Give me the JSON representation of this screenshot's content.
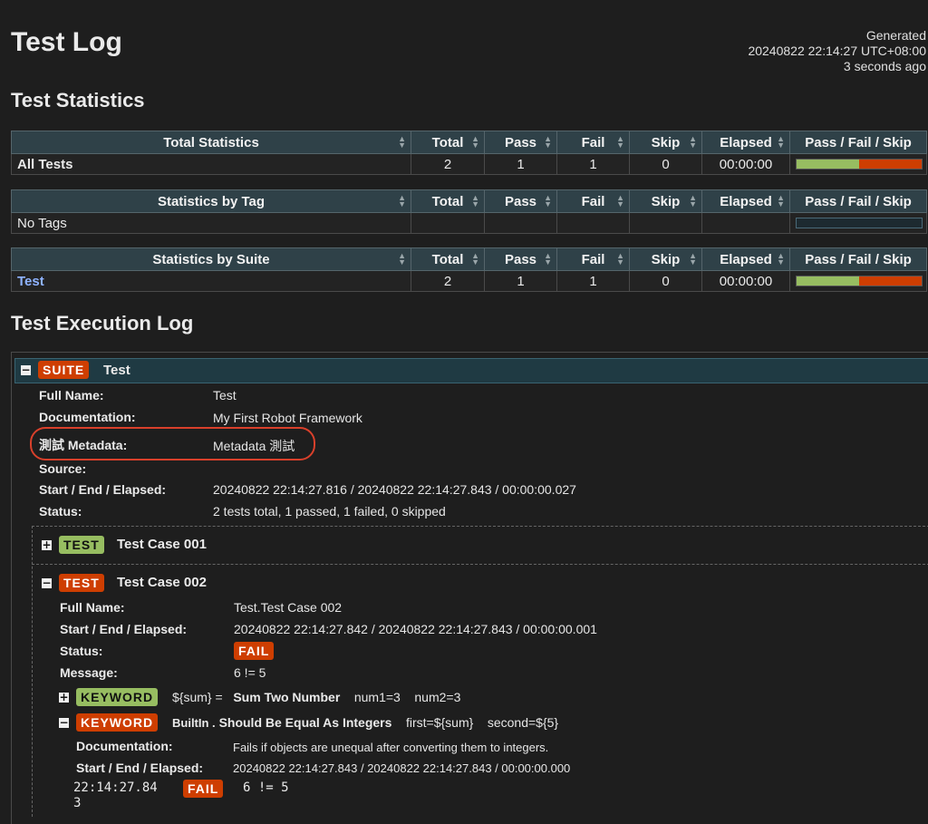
{
  "header": {
    "title": "Test Log",
    "generated_label": "Generated",
    "generated_time": "20240822 22:14:27 UTC+08:00",
    "generated_ago": "3 seconds ago"
  },
  "statistics": {
    "heading": "Test Statistics",
    "columns": [
      "Total",
      "Pass",
      "Fail",
      "Skip",
      "Elapsed",
      "Pass / Fail / Skip"
    ],
    "total": {
      "header": "Total Statistics",
      "row": {
        "name": "All Tests",
        "total": "2",
        "pass": "1",
        "fail": "1",
        "skip": "0",
        "elapsed": "00:00:00",
        "pass_ratio": 0.5
      }
    },
    "tag": {
      "header": "Statistics by Tag",
      "row": {
        "name": "No Tags"
      }
    },
    "suite": {
      "header": "Statistics by Suite",
      "row": {
        "name": "Test",
        "total": "2",
        "pass": "1",
        "fail": "1",
        "skip": "0",
        "elapsed": "00:00:00",
        "pass_ratio": 0.5
      }
    }
  },
  "execution": {
    "heading": "Test Execution Log",
    "suite": {
      "toggle": "−",
      "label": "SUITE",
      "name": "Test",
      "fields": {
        "full_name_key": "Full Name:",
        "full_name": "Test",
        "doc_key": "Documentation:",
        "doc": "My First Robot Framework",
        "meta_key": "測試 Metadata:",
        "meta": "Metadata 測試",
        "source_key": "Source:",
        "times_key": "Start / End / Elapsed:",
        "times": "20240822 22:14:27.816 / 20240822 22:14:27.843 / 00:00:00.027",
        "status_key": "Status:",
        "status": "2 tests total, 1 passed, 1 failed, 0 skipped"
      }
    },
    "test1": {
      "toggle": "+",
      "label": "TEST",
      "name": "Test Case 001"
    },
    "test2": {
      "toggle": "−",
      "label": "TEST",
      "name": "Test Case 002",
      "full_name_key": "Full Name:",
      "full_name": "Test.Test Case 002",
      "times_key": "Start / End / Elapsed:",
      "times": "20240822 22:14:27.842 / 20240822 22:14:27.843 / 00:00:00.001",
      "status_key": "Status:",
      "status": "FAIL",
      "message_key": "Message:",
      "message": "6 != 5"
    },
    "kw1": {
      "toggle": "+",
      "label": "KEYWORD",
      "assign": "${sum} =",
      "name": "Sum Two Number",
      "args": "num1=3    num2=3"
    },
    "kw2": {
      "toggle": "−",
      "label": "KEYWORD",
      "lib": "BuiltIn .",
      "name": "Should Be Equal As Integers",
      "args": "first=${sum}    second=${5}",
      "doc_key": "Documentation:",
      "doc": "Fails if objects are unequal after converting them to integers.",
      "times_key": "Start / End / Elapsed:",
      "times": "20240822 22:14:27.843 / 20240822 22:14:27.843 / 00:00:00.000",
      "msg_time_1": "22:14:27.84",
      "msg_time_2": "3",
      "msg_level": "FAIL",
      "msg_text": "6 != 5"
    }
  }
}
